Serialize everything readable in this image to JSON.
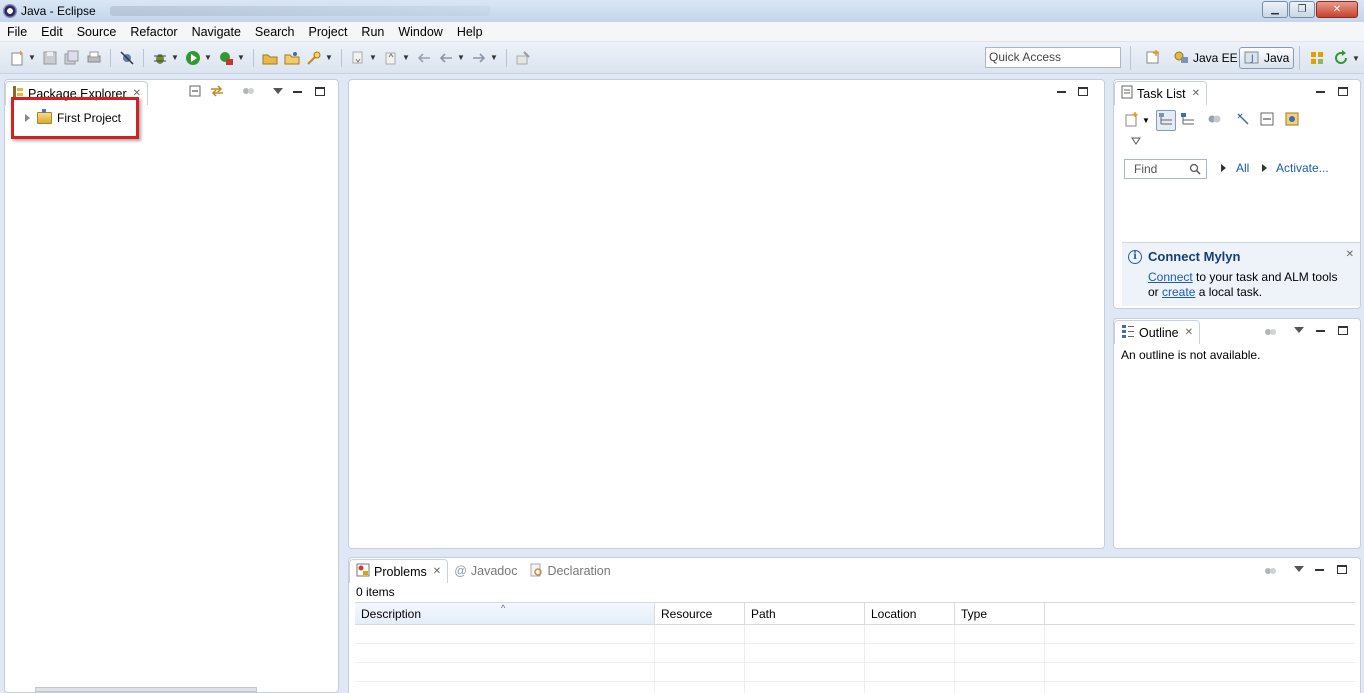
{
  "window": {
    "title": "Java - Eclipse",
    "buttons": {
      "minimize": "▁",
      "maximize": "❐",
      "close": "✕"
    }
  },
  "menu": [
    "File",
    "Edit",
    "Source",
    "Refactor",
    "Navigate",
    "Search",
    "Project",
    "Run",
    "Window",
    "Help"
  ],
  "toolbar": {
    "quick_access_placeholder": "Quick Access",
    "perspectives": {
      "java_ee": "Java EE",
      "java": "Java"
    }
  },
  "package_explorer": {
    "tab_label": "Package Explorer",
    "items": [
      {
        "label": "First Project"
      }
    ]
  },
  "task_list": {
    "tab_label": "Task List",
    "find_placeholder": "Find",
    "all_label": "All",
    "activate_label": "Activate...",
    "mylyn": {
      "title": "Connect Mylyn",
      "connect_link": "Connect",
      "text_1": " to your task and ALM tools",
      "text_or": "or ",
      "create_link": "create",
      "text_2": " a local task."
    }
  },
  "outline": {
    "tab_label": "Outline",
    "message": "An outline is not available."
  },
  "bottom": {
    "tabs": {
      "problems": "Problems",
      "javadoc": "Javadoc",
      "declaration": "Declaration"
    },
    "items_count": "0 items",
    "columns": [
      "Description",
      "Resource",
      "Path",
      "Location",
      "Type"
    ]
  }
}
